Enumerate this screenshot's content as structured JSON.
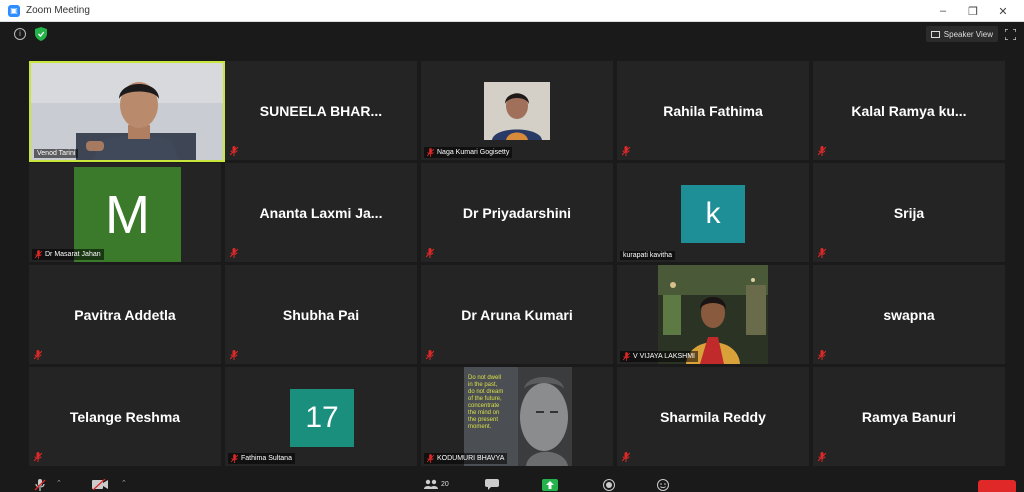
{
  "window": {
    "title": "Zoom Meeting"
  },
  "toolbar": {
    "speaker_view_label": "Speaker View",
    "participants_count": "20"
  },
  "participants": [
    {
      "name": "Venod Tarini",
      "display": "label",
      "mic": "muted"
    },
    {
      "name": "SUNEELA  BHAR...",
      "display": "name"
    },
    {
      "name": "Naga Kumari Gogisetty",
      "display": "label",
      "mic": "muted"
    },
    {
      "name": "Rahila Fathima",
      "display": "name"
    },
    {
      "name": "Kalal Ramya ku...",
      "display": "name"
    },
    {
      "name": "Dr Masarat Jahan",
      "display": "label",
      "avatar_letter": "M",
      "avatar_color": "#3b7a2a",
      "mic": "muted"
    },
    {
      "name": "Ananta Laxmi Ja...",
      "display": "name"
    },
    {
      "name": "Dr Priyadarshini",
      "display": "name"
    },
    {
      "name": "kurapati kavitha",
      "display": "label",
      "avatar_letter": "k",
      "avatar_color": "#1f8f97"
    },
    {
      "name": "Srija",
      "display": "name"
    },
    {
      "name": "Pavitra Addetla",
      "display": "name"
    },
    {
      "name": "Shubha Pai",
      "display": "name"
    },
    {
      "name": "Dr Aruna Kumari",
      "display": "name"
    },
    {
      "name": "V VIJAYA LAKSHMI",
      "display": "label",
      "mic": "muted"
    },
    {
      "name": "swapna",
      "display": "name"
    },
    {
      "name": "Telange Reshma",
      "display": "name"
    },
    {
      "name": "Fathima Sultana",
      "display": "label",
      "avatar_letter": "17",
      "avatar_color": "#1a8f7d",
      "mic": "muted"
    },
    {
      "name": "KODUMURI BHAVYA",
      "display": "label",
      "mic": "muted"
    },
    {
      "name": "Sharmila Reddy",
      "display": "name"
    },
    {
      "name": "Ramya Banuri",
      "display": "name"
    }
  ],
  "quote_lines": [
    "Do not dwell",
    "in the past,",
    "do not dream",
    "of the future,",
    "concentrate",
    "the mind on",
    "the present",
    "moment."
  ],
  "colors": {
    "active_speaker_border": "#c8e63c",
    "mute_red": "#e02828",
    "secure_green": "#23b34a"
  }
}
